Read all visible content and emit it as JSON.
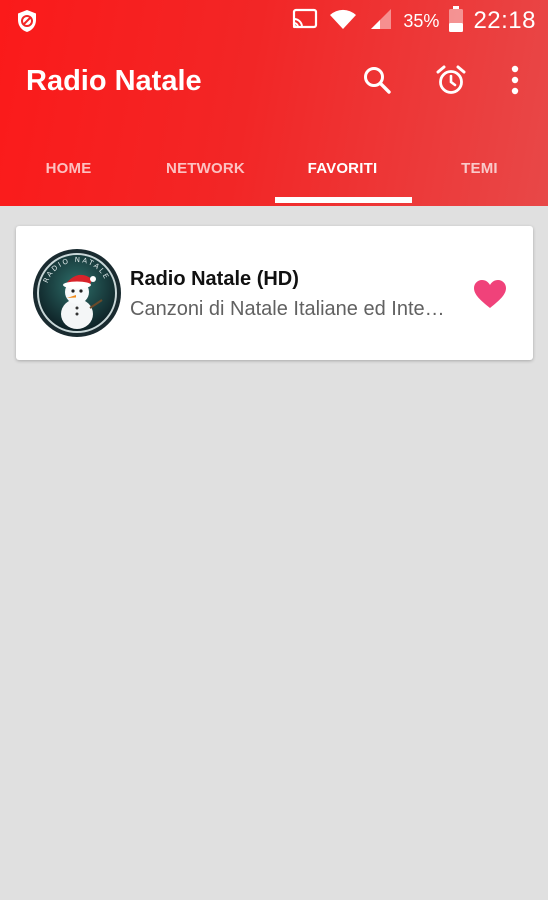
{
  "status_bar": {
    "battery_percent": "35%",
    "time": "22:18",
    "icons": [
      "vpn-shield-icon",
      "cast-icon",
      "wifi-icon",
      "signal-icon",
      "battery-icon"
    ]
  },
  "toolbar": {
    "title": "Radio Natale",
    "actions": [
      "search-icon",
      "alarm-icon",
      "more-vert-icon"
    ]
  },
  "tabs": [
    {
      "label": "HOME",
      "active": false
    },
    {
      "label": "NETWORK",
      "active": false
    },
    {
      "label": "FAVORITI",
      "active": true
    },
    {
      "label": "TEMI",
      "active": false
    }
  ],
  "favorites": [
    {
      "name": "Radio Natale (HD)",
      "description": "Canzoni di Natale Italiane ed Internazionali",
      "logo_text": "RADIO NATALE",
      "favorite": true
    }
  ],
  "colors": {
    "app_bar": "#f22626",
    "heart": "#f0427a",
    "background": "#e0e0e0"
  }
}
